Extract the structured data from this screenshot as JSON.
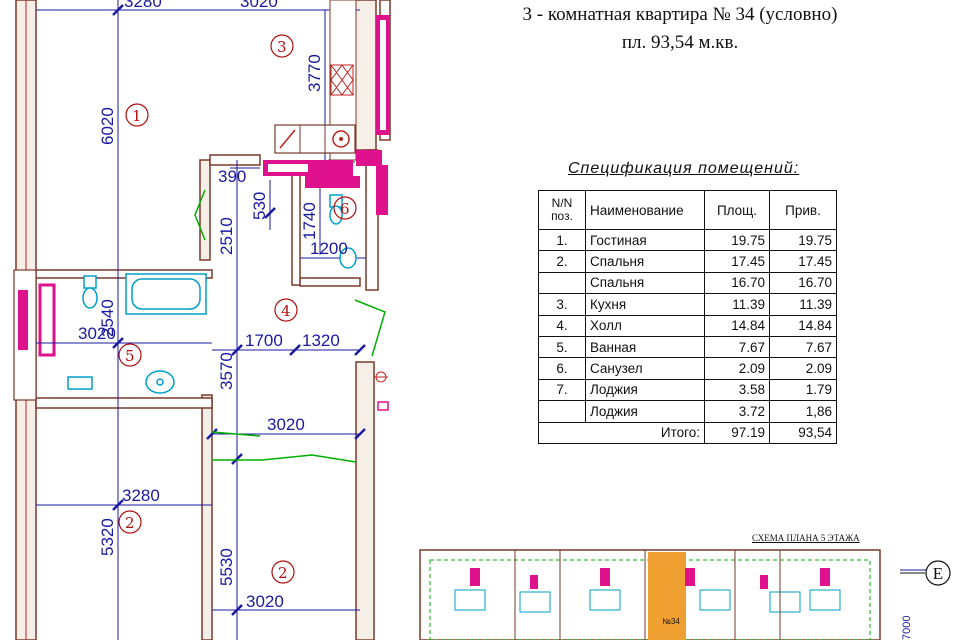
{
  "header": {
    "title": "3 - комнатная квартира № 34   (условно)",
    "area": "пл. 93,54 м.кв."
  },
  "spec": {
    "title": "Спецификация помещений:",
    "columns": [
      "N/N поз.",
      "Наименование",
      "Площ.",
      "Прив."
    ],
    "rows": [
      [
        "1.",
        "Гостиная",
        "19.75",
        "19.75"
      ],
      [
        "2.",
        "Спальня",
        "17.45",
        "17.45"
      ],
      [
        "",
        "Спальня",
        "16.70",
        "16.70"
      ],
      [
        "3.",
        "Кухня",
        "11.39",
        "11.39"
      ],
      [
        "4.",
        "Холл",
        "14.84",
        "14.84"
      ],
      [
        "5.",
        "Ванная",
        "7.67",
        "7.67"
      ],
      [
        "6.",
        "Санузел",
        "2.09",
        "2.09"
      ],
      [
        "7.",
        "Лоджия",
        "3.58",
        "1.79"
      ],
      [
        "",
        "Лоджия",
        "3.72",
        "1,86"
      ]
    ],
    "total": [
      "Итого:",
      "97.19",
      "93,54"
    ]
  },
  "plan": {
    "dims": {
      "d3280_top": "3280",
      "d3020_top": "3020",
      "d6020": "6020",
      "d3770": "3770",
      "d390": "390",
      "d530": "530",
      "d2510": "2510",
      "d1740": "1740",
      "d1200": "1200",
      "d2540": "2540",
      "d3020_bath": "3020",
      "d1700": "1700",
      "d1320": "1320",
      "d3570": "3570",
      "d3020_hall": "3020",
      "d3280_bed": "3280",
      "d5320": "5320",
      "d5530": "5530",
      "d3020_bed": "3020",
      "d7000": "7000"
    },
    "rooms": {
      "r1": "1",
      "r2a": "2",
      "r2b": "2",
      "r3": "3",
      "r4": "4",
      "r5": "5",
      "r6": "6"
    },
    "axis_label": "E",
    "scheme_title": "СХЕМА ПЛАНА  5 ЭТАЖА",
    "scheme_marker": "№34"
  },
  "colors": {
    "wall": "#7a3a2a",
    "dimension": "#1a1aa0",
    "room_number": "#b01010",
    "fixture": "#e0118c",
    "window": "#00b000",
    "fixture_blue": "#00a0c8",
    "highlight": "#f0a030"
  }
}
